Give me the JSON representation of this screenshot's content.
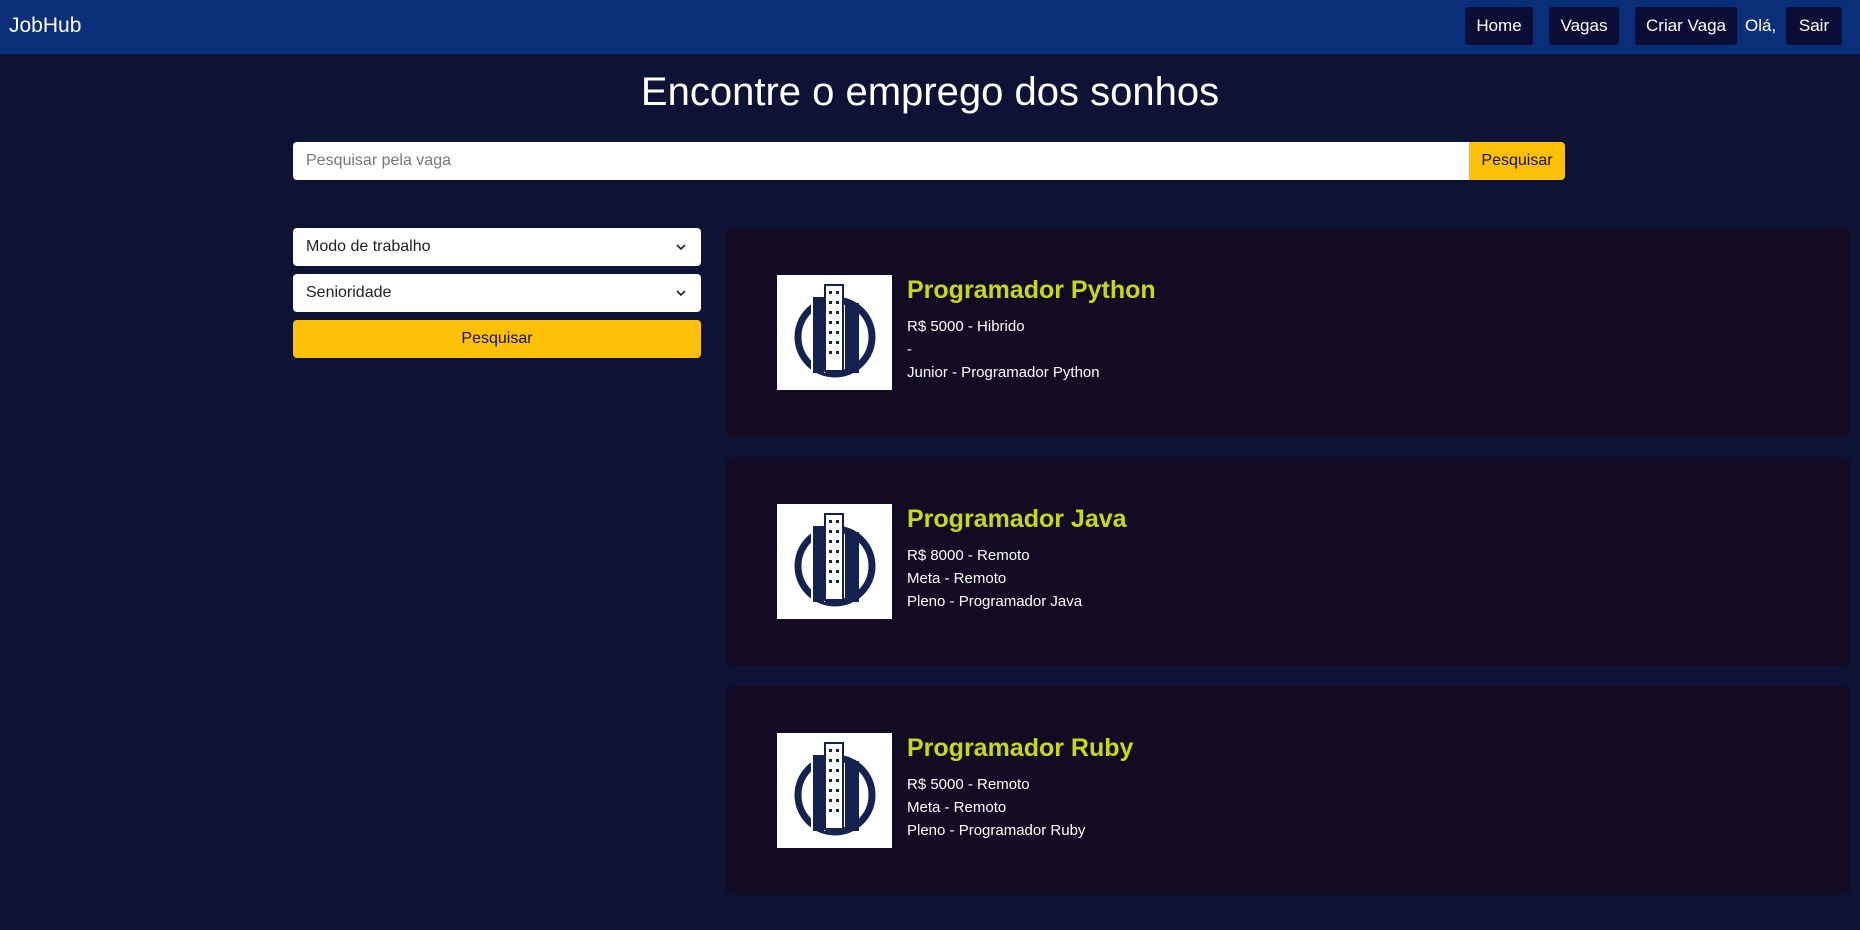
{
  "nav": {
    "brand": "JobHub",
    "home": "Home",
    "vagas": "Vagas",
    "criar_vaga": "Criar Vaga",
    "greeting": "Olá,",
    "sair": "Sair"
  },
  "hero": {
    "title": "Encontre o emprego dos sonhos"
  },
  "search": {
    "placeholder": "Pesquisar pela vaga",
    "button": "Pesquisar"
  },
  "filters": {
    "modo": "Modo de trabalho",
    "senioridade": "Senioridade",
    "button": "Pesquisar"
  },
  "jobs": [
    {
      "title": "Programador Python",
      "line1": "R$ 5000 - Hibrido",
      "line2": "-",
      "line3": "Junior - Programador Python"
    },
    {
      "title": "Programador Java",
      "line1": "R$ 8000 - Remoto",
      "line2": "Meta - Remoto",
      "line3": "Pleno - Programador Java"
    },
    {
      "title": "Programador Ruby",
      "line1": "R$ 5000 - Remoto",
      "line2": "Meta - Remoto",
      "line3": "Pleno - Programador Ruby"
    }
  ],
  "colors": {
    "background": "#0e1235",
    "navbar": "#0a2e78",
    "accent": "#ffc107",
    "job_title": "#c8d911",
    "card": "#130b23"
  }
}
